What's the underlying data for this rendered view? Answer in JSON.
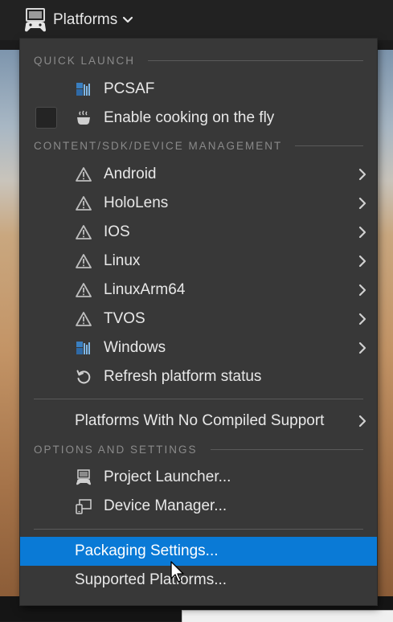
{
  "toolbar": {
    "platforms_label": "Platforms"
  },
  "menu": {
    "quick_launch": {
      "header": "QUICK LAUNCH",
      "pcsaf_label": "PCSAF",
      "cooking_label": "Enable cooking on the fly",
      "cooking_checked": false
    },
    "content_mgmt": {
      "header": "CONTENT/SDK/DEVICE MANAGEMENT",
      "platforms": [
        {
          "label": "Android",
          "icon": "warning-icon"
        },
        {
          "label": "HoloLens",
          "icon": "warning-icon"
        },
        {
          "label": "IOS",
          "icon": "warning-icon"
        },
        {
          "label": "Linux",
          "icon": "warning-icon"
        },
        {
          "label": "LinuxArm64",
          "icon": "warning-icon"
        },
        {
          "label": "TVOS",
          "icon": "warning-icon"
        },
        {
          "label": "Windows",
          "icon": "windows-platform-icon"
        }
      ],
      "refresh_label": "Refresh platform status"
    },
    "no_compiled_label": "Platforms With No Compiled Support",
    "options": {
      "header": "OPTIONS AND SETTINGS",
      "project_launcher_label": "Project Launcher...",
      "device_manager_label": "Device Manager..."
    },
    "packaging_settings_label": "Packaging Settings...",
    "supported_platforms_label": "Supported Platforms..."
  },
  "colors": {
    "highlight": "#0a7ad6",
    "menu_bg": "#383838",
    "text": "#e8e8e8",
    "header_text": "#8a8a8a"
  }
}
